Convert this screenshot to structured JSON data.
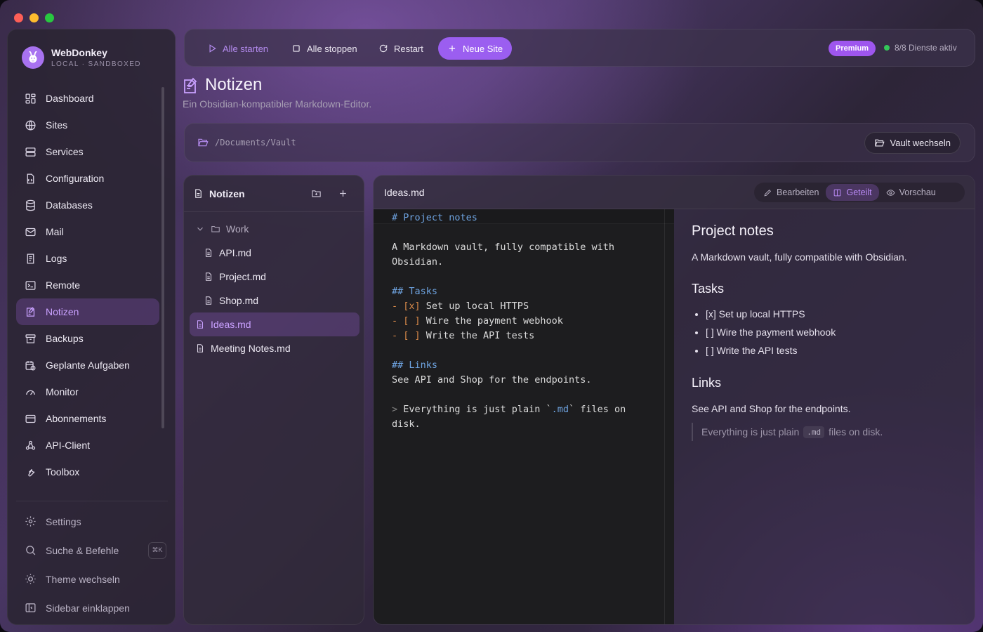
{
  "brand": {
    "name": "WebDonkey",
    "subtitle": "LOCAL · SANDBOXED"
  },
  "sidebar": {
    "items": [
      {
        "label": "Dashboard",
        "icon": "dashboard-icon"
      },
      {
        "label": "Sites",
        "icon": "globe-icon"
      },
      {
        "label": "Services",
        "icon": "server-icon"
      },
      {
        "label": "Configuration",
        "icon": "config-file-icon"
      },
      {
        "label": "Databases",
        "icon": "database-icon"
      },
      {
        "label": "Mail",
        "icon": "mail-icon"
      },
      {
        "label": "Logs",
        "icon": "logs-icon"
      },
      {
        "label": "Remote",
        "icon": "terminal-icon"
      },
      {
        "label": "Notizen",
        "icon": "notes-icon",
        "active": true
      },
      {
        "label": "Backups",
        "icon": "archive-icon"
      },
      {
        "label": "Geplante Aufgaben",
        "icon": "calendar-clock-icon"
      },
      {
        "label": "Monitor",
        "icon": "gauge-icon"
      },
      {
        "label": "Abonnements",
        "icon": "credit-card-icon"
      },
      {
        "label": "API-Client",
        "icon": "webhook-icon"
      },
      {
        "label": "Toolbox",
        "icon": "wrench-icon"
      }
    ],
    "footer": {
      "settings": "Settings",
      "search": "Suche & Befehle",
      "search_shortcut": "⌘K",
      "theme": "Theme wechseln",
      "collapse": "Sidebar einklappen"
    }
  },
  "toolbar": {
    "start_all": "Alle starten",
    "stop_all": "Alle stoppen",
    "restart": "Restart",
    "new_site": "Neue Site",
    "premium_badge": "Premium",
    "status_text": "8/8 Dienste aktiv",
    "status_color": "#34c759"
  },
  "page": {
    "title": "Notizen",
    "subtitle": "Ein Obsidian-kompatibler Markdown-Editor."
  },
  "vault": {
    "path": "/Documents/Vault",
    "switch_label": "Vault wechseln"
  },
  "tree": {
    "title": "Notizen",
    "folder": "Work",
    "folder_files": [
      "API.md",
      "Project.md",
      "Shop.md"
    ],
    "root_files": [
      "Ideas.md",
      "Meeting Notes.md"
    ],
    "active_file": "Ideas.md"
  },
  "editor": {
    "file_name": "Ideas.md",
    "modes": [
      "Bearbeiten",
      "Geteilt",
      "Vorschau"
    ],
    "active_mode": "Geteilt",
    "source": {
      "h1": "# Project notes",
      "p1a": "A Markdown vault, fully compatible with",
      "p1b": "Obsidian.",
      "h2a": "## Tasks",
      "t1_mark": "- [x]",
      "t1_text": " Set up local HTTPS",
      "t2_mark": "- [ ]",
      "t2_text": " Wire the payment webhook",
      "t3_mark": "- [ ]",
      "t3_text": " Write the API tests",
      "h2b": "## Links",
      "p2": "See API and Shop for the endpoints.",
      "q_mark": ">",
      "q_text1": " Everything is just plain `",
      "q_code": ".md",
      "q_text2": "` files on",
      "q_text3": "disk."
    },
    "preview": {
      "h1": "Project notes",
      "p1": "A Markdown vault, fully compatible with Obsidian.",
      "h2a": "Tasks",
      "tasks": [
        "[x] Set up local HTTPS",
        "[ ] Wire the payment webhook",
        "[ ] Write the API tests"
      ],
      "h2b": "Links",
      "p2": "See API and Shop for the endpoints.",
      "quote_a": "Everything is just plain",
      "quote_code": ".md",
      "quote_b": "files on disk."
    }
  },
  "colors": {
    "accent": "#9b5ef0",
    "accent_text": "#c9a1ff"
  }
}
